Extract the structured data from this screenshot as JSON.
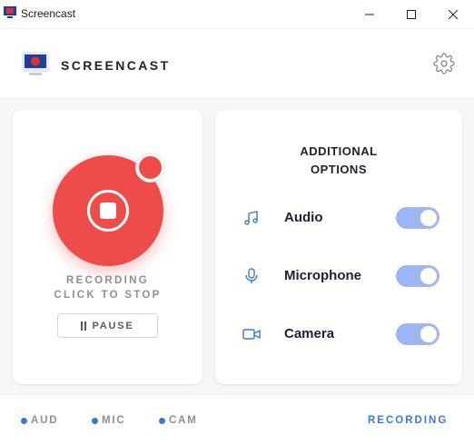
{
  "window": {
    "title": "Screencast",
    "app_icon": "monitor-record-icon"
  },
  "header": {
    "brand": "SCREENCAST",
    "settings_icon": "gear-icon"
  },
  "recorder": {
    "status_line1": "RECORDING",
    "status_line2": "CLICK TO STOP",
    "pause_label": "PAUSE",
    "accent_color": "#ee4b4b"
  },
  "options": {
    "title_line1": "ADDITIONAL",
    "title_line2": "OPTIONS",
    "items": [
      {
        "label": "Audio",
        "icon": "music-note-icon",
        "enabled": true
      },
      {
        "label": "Microphone",
        "icon": "microphone-icon",
        "enabled": true
      },
      {
        "label": "Camera",
        "icon": "video-camera-icon",
        "enabled": true
      }
    ],
    "toggle_color": "#9db8f0"
  },
  "footer": {
    "indicators": [
      "AUD",
      "MIC",
      "CAM"
    ],
    "status": "RECORDING",
    "accent_color": "#3c78d8"
  }
}
